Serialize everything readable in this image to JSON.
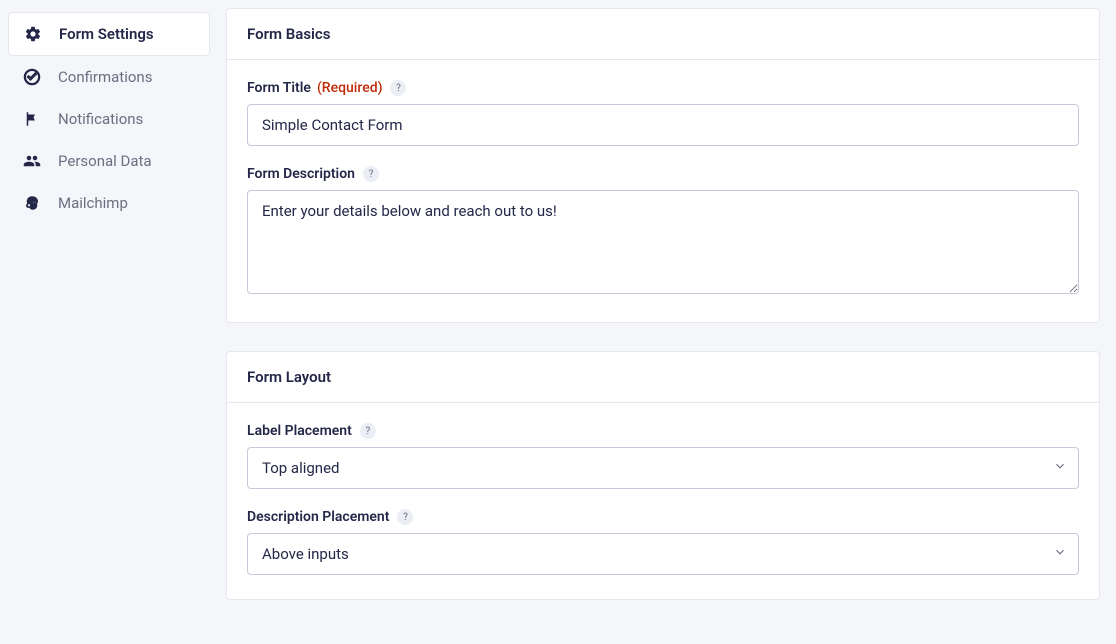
{
  "sidebar": {
    "items": [
      {
        "label": "Form Settings",
        "icon": "gear-icon",
        "active": true
      },
      {
        "label": "Confirmations",
        "icon": "check-circle-icon",
        "active": false
      },
      {
        "label": "Notifications",
        "icon": "flag-icon",
        "active": false
      },
      {
        "label": "Personal Data",
        "icon": "users-icon",
        "active": false
      },
      {
        "label": "Mailchimp",
        "icon": "mailchimp-icon",
        "active": false
      }
    ]
  },
  "panels": {
    "basics": {
      "title": "Form Basics",
      "formTitle": {
        "label": "Form Title",
        "requiredTag": "(Required)",
        "value": "Simple Contact Form"
      },
      "formDescription": {
        "label": "Form Description",
        "value": "Enter your details below and reach out to us!"
      }
    },
    "layout": {
      "title": "Form Layout",
      "labelPlacement": {
        "label": "Label Placement",
        "value": "Top aligned"
      },
      "descriptionPlacement": {
        "label": "Description Placement",
        "value": "Above inputs"
      }
    }
  },
  "helpGlyph": "?"
}
